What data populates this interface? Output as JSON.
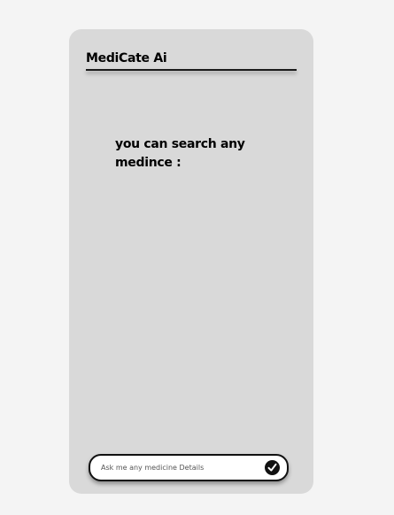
{
  "header": {
    "title": "MediCate Ai"
  },
  "main": {
    "prompt_text": "you can search any medince :"
  },
  "search": {
    "placeholder": "Ask me any medicine Details",
    "value": "",
    "submit_icon": "check-circle-icon"
  },
  "colors": {
    "page_background": "#f4f4f4",
    "card_background": "#d9d9d9",
    "accent": "#111111"
  }
}
